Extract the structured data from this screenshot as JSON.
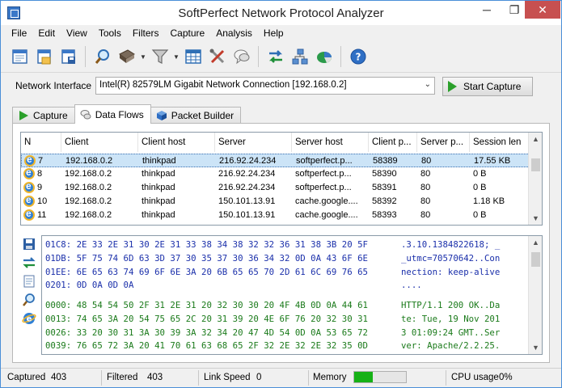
{
  "window": {
    "title": "SoftPerfect Network Protocol Analyzer"
  },
  "titlebar_buttons": {
    "minimize": "─",
    "maximize": "❐",
    "close": "✕"
  },
  "menu": [
    "File",
    "Edit",
    "View",
    "Tools",
    "Filters",
    "Capture",
    "Analysis",
    "Help"
  ],
  "toolbar_icons": [
    "new-session-icon",
    "open-file-icon",
    "save-file-icon",
    "search-icon",
    "bookmark-icon",
    "filter-icon",
    "table-icon",
    "tools-icon",
    "chat-icon",
    "swap-arrows-icon",
    "network-icon",
    "pie-chart-icon",
    "help-icon"
  ],
  "interface": {
    "label": "Network Interface",
    "value": "Intel(R) 82579LM Gigabit Network Connection [192.168.0.2]",
    "start_button": "Start Capture"
  },
  "tabs": [
    "Capture",
    "Data Flows",
    "Packet Builder"
  ],
  "active_tab": "Data Flows",
  "flows": {
    "columns": [
      "N",
      "Client",
      "Client host",
      "Server",
      "Server host",
      "Client p...",
      "Server p...",
      "Session len"
    ],
    "rows": [
      [
        "7",
        "192.168.0.2",
        "thinkpad",
        "216.92.24.234",
        "softperfect.p...",
        "58389",
        "80",
        "17.55 KB"
      ],
      [
        "8",
        "192.168.0.2",
        "thinkpad",
        "216.92.24.234",
        "softperfect.p...",
        "58390",
        "80",
        "0 B"
      ],
      [
        "9",
        "192.168.0.2",
        "thinkpad",
        "216.92.24.234",
        "softperfect.p...",
        "58391",
        "80",
        "0 B"
      ],
      [
        "10",
        "192.168.0.2",
        "thinkpad",
        "150.101.13.91",
        "cache.google....",
        "58392",
        "80",
        "1.18 KB"
      ],
      [
        "11",
        "192.168.0.2",
        "thinkpad",
        "150.101.13.91",
        "cache.google....",
        "58393",
        "80",
        "0 B"
      ]
    ],
    "selected_index": 0
  },
  "hex": {
    "blue_lines": [
      "01C8: 2E 33 2E 31 30 2E 31 33 38 34 38 32 32 36 31 38 3B 20 5F",
      "01DB: 5F 75 74 6D 63 3D 37 30 35 37 30 36 34 32 0D 0A 43 6F 6E",
      "01EE: 6E 65 63 74 69 6F 6E 3A 20 6B 65 65 70 2D 61 6C 69 76 65",
      "0201: 0D 0A 0D 0A"
    ],
    "blue_ascii": [
      ".3.10.1384822618; _",
      "_utmc=70570642..Con",
      "nection: keep-alive",
      "...."
    ],
    "green_lines": [
      "0000: 48 54 54 50 2F 31 2E 31 20 32 30 30 20 4F 4B 0D 0A 44 61",
      "0013: 74 65 3A 20 54 75 65 2C 20 31 39 20 4E 6F 76 20 32 30 31",
      "0026: 33 20 30 31 3A 30 39 3A 32 34 20 47 4D 54 0D 0A 53 65 72",
      "0039: 76 65 72 3A 20 41 70 61 63 68 65 2F 32 2E 32 2E 32 35 0D"
    ],
    "green_ascii": [
      "HTTP/1.1 200 OK..Da",
      "te: Tue, 19 Nov 201",
      "3 01:09:24 GMT..Ser",
      "ver: Apache/2.2.25."
    ]
  },
  "status": {
    "captured_label": "Captured",
    "captured_value": "403",
    "filtered_label": "Filtered",
    "filtered_value": "403",
    "linkspeed_label": "Link Speed",
    "linkspeed_value": "0",
    "memory_label": "Memory",
    "memory_fraction": 0.36,
    "cpu_label": "CPU usage",
    "cpu_value": "0%"
  },
  "colors": {
    "accent": "#3a78c8",
    "hex_blue": "#1a2faa",
    "hex_green": "#1a7a1a",
    "memory_fill": "#16b116",
    "close_button": "#c75050"
  }
}
